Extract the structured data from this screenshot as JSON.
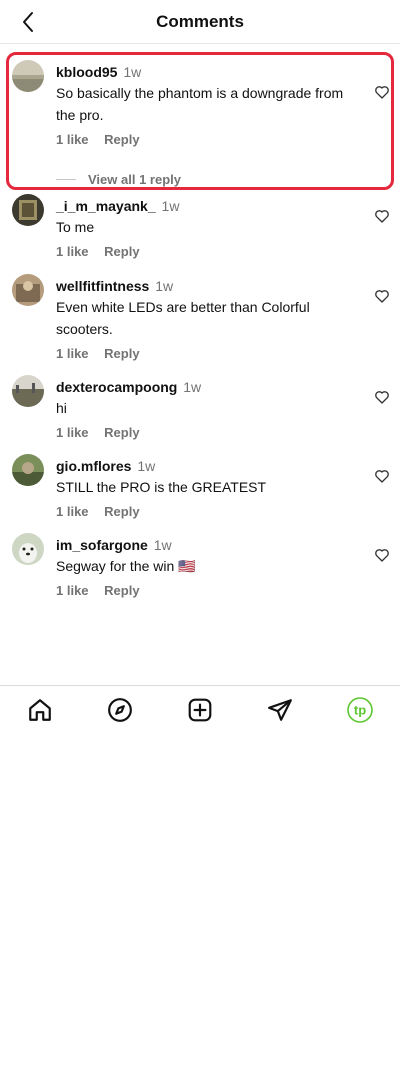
{
  "header": {
    "title": "Comments",
    "back_icon": "chevron-left-icon"
  },
  "comments": [
    {
      "username": "kblood95",
      "time": "1w",
      "text": "So basically the phantom is a downgrade from the pro.",
      "likes": "1 like",
      "reply_label": "Reply",
      "view_replies": "View all 1 reply",
      "highlighted": true
    },
    {
      "username": "_i_m_mayank_",
      "time": "1w",
      "text": "To me",
      "likes": "1 like",
      "reply_label": "Reply"
    },
    {
      "username": "wellfitfintness",
      "time": "1w",
      "text": "Even white LEDs are better than Colorful scooters.",
      "likes": "1 like",
      "reply_label": "Reply"
    },
    {
      "username": "dexterocampoong",
      "time": "1w",
      "text": "hi",
      "likes": "1 like",
      "reply_label": "Reply"
    },
    {
      "username": "gio.mflores",
      "time": "1w",
      "text": "STILL the PRO is the GREATEST",
      "likes": "1 like",
      "reply_label": "Reply"
    },
    {
      "username": "im_sofargone",
      "time": "1w",
      "text": "Segway for the win 🇺🇸",
      "likes": "1 like",
      "reply_label": "Reply"
    }
  ],
  "bottom_nav": {
    "items": [
      "home-icon",
      "explore-compass-icon",
      "create-plus-icon",
      "direct-send-icon",
      "profile-avatar-icon"
    ],
    "profile_initials": "tp",
    "accent_color": "#5cc72e"
  },
  "colors": {
    "highlight": "#e5283e",
    "secondary_text": "#737373"
  }
}
